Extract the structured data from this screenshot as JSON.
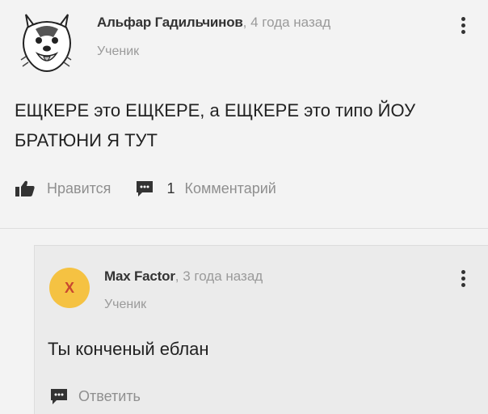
{
  "post": {
    "author": "Альфар Гадильчинов",
    "time": "4 года назад",
    "role": "Ученик",
    "text": "ЕЩКЕРЕ это ЕЩКЕРЕ, а ЕЩКЕРЕ это типо ЙОУ БРАТЮНИ Я ТУТ",
    "like_label": "Нравится",
    "comment_count": "1",
    "comment_label": "Комментарий"
  },
  "comment": {
    "avatar_letter": "X",
    "author": "Max Factor",
    "time": "3 года назад",
    "role": "Ученик",
    "text": "Ты конченый еблан",
    "reply_label": "Ответить"
  },
  "colors": {
    "background": "#f3f3f3",
    "comment_background": "#ebebeb",
    "avatar_yellow": "#f5c242",
    "muted_text": "#9a9a9a"
  },
  "icons": {
    "like": "thumbs-up-icon",
    "comment": "comment-bubble-icon",
    "menu": "kebab-menu-icon"
  }
}
